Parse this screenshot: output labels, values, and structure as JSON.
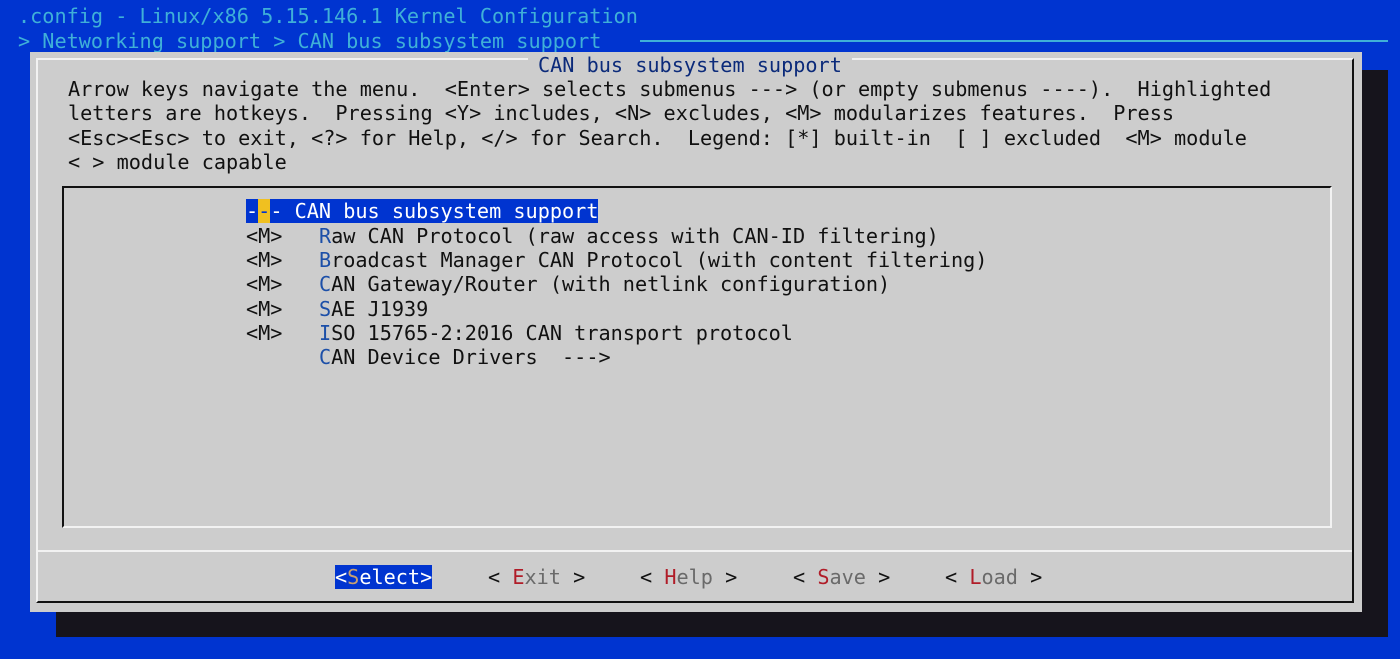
{
  "window": {
    "title": ".config - Linux/x86 5.15.146.1 Kernel Configuration",
    "breadcrumb": "> Networking support > CAN bus subsystem support"
  },
  "dialog": {
    "title": "CAN bus subsystem support",
    "help_lines": [
      "Arrow keys navigate the menu.  <Enter> selects submenus ---> (or empty submenus ----).  Highlighted",
      "letters are hotkeys.  Pressing <Y> includes, <N> excludes, <M> modularizes features.  Press",
      "<Esc><Esc> to exit, <?> for Help, </> for Search.  Legend: [*] built-in  [ ] excluded  <M> module",
      "< > module capable"
    ]
  },
  "menu": {
    "items": [
      {
        "prefix": "-",
        "hotkey": "-",
        "rest": "- CAN bus subsystem support",
        "selected": true
      },
      {
        "prefix": "<M>   ",
        "hotkey": "R",
        "rest": "aw CAN Protocol (raw access with CAN-ID filtering)"
      },
      {
        "prefix": "<M>   ",
        "hotkey": "B",
        "rest": "roadcast Manager CAN Protocol (with content filtering)"
      },
      {
        "prefix": "<M>   ",
        "hotkey": "C",
        "rest": "AN Gateway/Router (with netlink configuration)"
      },
      {
        "prefix": "<M>   ",
        "hotkey": "S",
        "rest": "AE J1939"
      },
      {
        "prefix": "<M>   ",
        "hotkey": "I",
        "rest": "SO 15765-2:2016 CAN transport protocol"
      },
      {
        "prefix": "      ",
        "hotkey": "C",
        "rest": "AN Device Drivers  --->"
      }
    ]
  },
  "buttons": [
    {
      "left": "<",
      "hotkey": "S",
      "rest": "elect",
      "right": ">",
      "selected": true
    },
    {
      "left": "< ",
      "hotkey": "E",
      "rest": "xit",
      "right": " >"
    },
    {
      "left": "< ",
      "hotkey": "H",
      "rest": "elp",
      "right": " >"
    },
    {
      "left": "< ",
      "hotkey": "S",
      "rest": "ave",
      "right": " >"
    },
    {
      "left": "< ",
      "hotkey": "L",
      "rest": "oad",
      "right": " >"
    }
  ],
  "colors": {
    "background": "#0034d0",
    "dialog": "#cdcdcd",
    "hotkey_menu": "#1c4fa8",
    "hotkey_button": "#b01c28",
    "highlight": "#f0c020"
  }
}
